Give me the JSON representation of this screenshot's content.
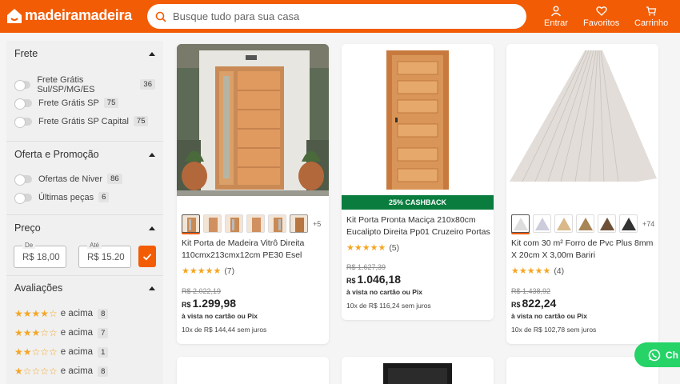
{
  "header": {
    "logo_text": "madeiramadeira",
    "search_placeholder": "Busque tudo para sua casa",
    "nav": [
      {
        "label": "Entrar",
        "icon": "user-icon"
      },
      {
        "label": "Favoritos",
        "icon": "heart-icon"
      },
      {
        "label": "Carrinho",
        "icon": "cart-icon"
      }
    ],
    "brand_color": "#f25c05"
  },
  "filters": {
    "frete": {
      "title": "Frete",
      "options": [
        {
          "label": "Frete Grátis Sul/SP/MG/ES",
          "count": "36"
        },
        {
          "label": "Frete Grátis SP",
          "count": "75"
        },
        {
          "label": "Frete Grátis SP Capital",
          "count": "75"
        }
      ]
    },
    "oferta": {
      "title": "Oferta e Promoção",
      "options": [
        {
          "label": "Ofertas de Niver",
          "count": "86"
        },
        {
          "label": "Últimas peças",
          "count": "6"
        }
      ]
    },
    "preco": {
      "title": "Preço",
      "from_label": "De",
      "from_value": "R$ 18,00",
      "to_label": "Até",
      "to_value": "R$ 15.20"
    },
    "avaliacoes": {
      "title": "Avaliações",
      "rows": [
        {
          "stars": "★★★★☆",
          "label": "e acima",
          "count": "8"
        },
        {
          "stars": "★★★☆☆",
          "label": "e acima",
          "count": "7"
        },
        {
          "stars": "★★☆☆☆",
          "label": "e acima",
          "count": "1"
        },
        {
          "stars": "★☆☆☆☆",
          "label": "e acima",
          "count": "8"
        }
      ]
    }
  },
  "products": [
    {
      "thumbs_more": "+5",
      "title": "Kit Porta de Madeira Vitrô Direita 110cmx213cmx12cm PE30 Esel",
      "stars": "★★★★★",
      "reviews": "(7)",
      "old_price": "R$ 2.022,19",
      "currency": "R$",
      "price": "1.299,98",
      "pix": "à vista no cartão ou Pix",
      "installments": "10x de R$ 144,44 sem juros"
    },
    {
      "cashback": "25% CASHBACK",
      "title": "Kit Porta Pronta Maciça 210x80cm Eucalipto Direita Pp01 Cruzeiro Portas",
      "stars": "★★★★★",
      "reviews": "(5)",
      "old_price": "R$ 1.627,39",
      "currency": "R$",
      "price": "1.046,18",
      "pix": "à vista no cartão ou Pix",
      "installments": "10x de R$ 116,24 sem juros"
    },
    {
      "thumbs_more": "+74",
      "title": "Kit com 30 m² Forro de Pvc Plus 8mm X 20cm X 3,00m Bariri",
      "stars": "★★★★★",
      "reviews": "(4)",
      "old_price": "R$ 1.438,92",
      "currency": "R$",
      "price": "822,24",
      "pix": "à vista no cartão ou Pix",
      "installments": "10x de R$ 102,78 sem juros"
    }
  ],
  "whatsapp": {
    "label": "Ch"
  }
}
